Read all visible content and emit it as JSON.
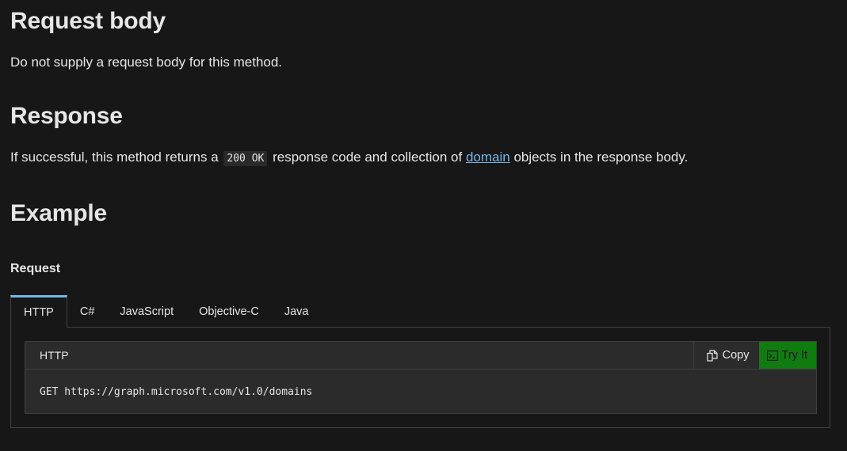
{
  "sections": {
    "request_body": {
      "heading": "Request body",
      "text": "Do not supply a request body for this method."
    },
    "response": {
      "heading": "Response",
      "text_before_code": "If successful, this method returns a",
      "code": "200 OK",
      "text_middle": "response code and collection of",
      "link_text": "domain",
      "text_after_link": "objects in the response body."
    },
    "example": {
      "heading": "Example",
      "subheading": "Request"
    }
  },
  "tabs": [
    {
      "label": "HTTP",
      "active": true
    },
    {
      "label": "C#",
      "active": false
    },
    {
      "label": "JavaScript",
      "active": false
    },
    {
      "label": "Objective-C",
      "active": false
    },
    {
      "label": "Java",
      "active": false
    }
  ],
  "code_block": {
    "language": "HTTP",
    "copy_label": "Copy",
    "try_label": "Try It",
    "code": "GET https://graph.microsoft.com/v1.0/domains"
  },
  "colors": {
    "background": "#171717",
    "text": "#e6e6e6",
    "link": "#75b6e7",
    "tab_accent": "#75b6e7",
    "try_button": "#107c10",
    "code_bg": "#2b2b2b",
    "border": "#404040"
  },
  "icons": {
    "copy": "copy-icon",
    "try": "terminal-icon"
  }
}
